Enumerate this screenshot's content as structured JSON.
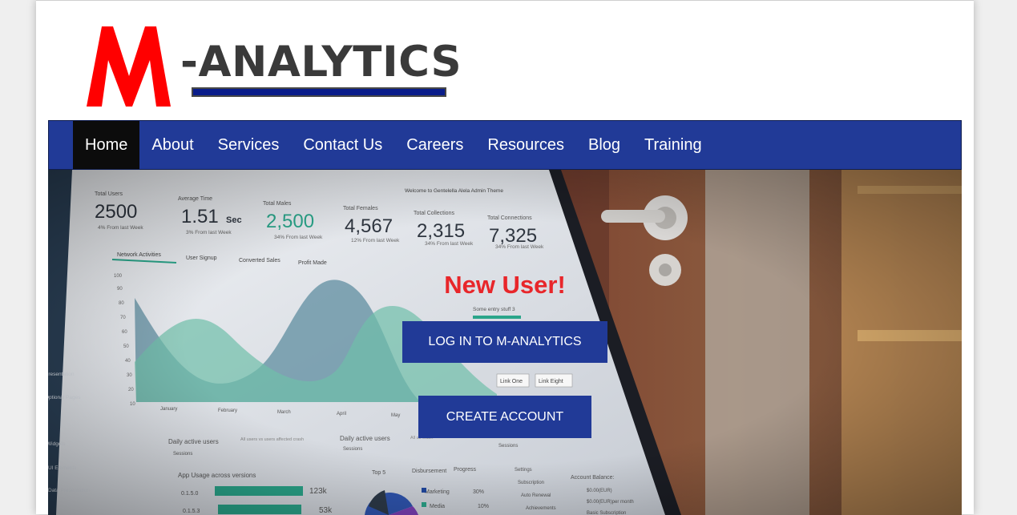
{
  "logo": {
    "letter": "M",
    "text": "-ANALYTICS",
    "brand_red": "#ff0000",
    "underline_color": "#0a1d8a"
  },
  "nav": {
    "items": [
      {
        "label": "Home",
        "active": true
      },
      {
        "label": "About"
      },
      {
        "label": "Services"
      },
      {
        "label": "Contact Us"
      },
      {
        "label": "Careers"
      },
      {
        "label": "Resources"
      },
      {
        "label": "Blog"
      },
      {
        "label": "Training"
      }
    ],
    "bg_color": "#213a97"
  },
  "hero": {
    "title": "New User!",
    "login_button": "LOG IN TO M-ANALYTICS",
    "create_button": "CREATE ACCOUNT",
    "title_color": "#e8262a",
    "button_color": "#213a97"
  },
  "dashboard": {
    "stats": [
      {
        "label": "Total Users",
        "value": "2500",
        "sub": "4% From last Week"
      },
      {
        "label": "Average Time",
        "value": "1.51",
        "unit": "Sec",
        "sub": "3% From last Week"
      },
      {
        "label": "Total Males",
        "value": "2,500",
        "sub": "34% From last Week"
      },
      {
        "label": "Total Females",
        "value": "4,567",
        "sub": "12% From last Week"
      },
      {
        "label": "Total Collections",
        "value": "2,315",
        "sub": "34% From last Week"
      },
      {
        "label": "Total Connections",
        "value": "7,325",
        "sub": "34% From last Week"
      }
    ],
    "tabs": [
      "Network Activities",
      "User Signup",
      "Converted Sales",
      "Profit Made"
    ],
    "welcome": "Welcome to Gentelella Alela Admin Theme",
    "months": [
      "January",
      "February",
      "March",
      "April",
      "May"
    ],
    "y_ticks": [
      "100",
      "90",
      "80",
      "70",
      "60",
      "50",
      "40",
      "30",
      "20",
      "10"
    ],
    "links": [
      "Link One",
      "Link Eight"
    ],
    "some_entry": "Some entry stuff 3",
    "panel1_title": "Daily active users",
    "panel1_sub": "Sessions",
    "panel1_note": "All users vs users affected crash",
    "app_usage": "App Usage across versions",
    "bar_rows": [
      {
        "label": "0.1.5.0",
        "value": "123k"
      },
      {
        "label": "0.1.5.3",
        "value": "53k"
      }
    ],
    "panel2_title": "Daily active users",
    "panel2_sub": "Sessions",
    "panel2_note": "All us crash",
    "top5": "Top 5",
    "disbursement": "Disbursement",
    "progress": "Progress",
    "pie_items": [
      {
        "label": "Marketing",
        "value": "30%"
      },
      {
        "label": "Media",
        "value": "10%"
      }
    ],
    "panel3_sub": "Sessions",
    "settings": [
      "Settings",
      "Subscription",
      "Auto Renewal",
      "Achievements"
    ],
    "account_balance": "Account Balance:",
    "balance_lines": [
      "$0.00(EUR)",
      "$0.00(EUR) per month",
      "Basic Subscription"
    ],
    "sidebar_items": [
      "Presentation",
      "Optional Pages",
      "Widgets",
      "UI Elements",
      "Data Presentation"
    ]
  }
}
